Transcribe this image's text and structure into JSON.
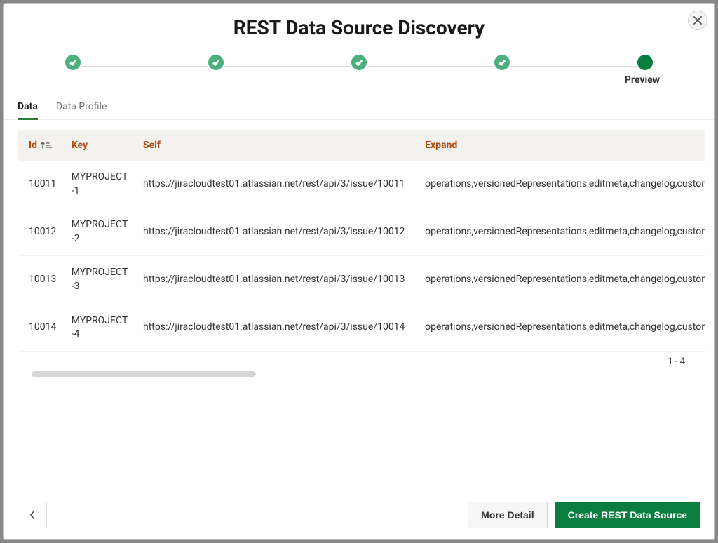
{
  "dialog": {
    "title": "REST Data Source Discovery",
    "current_step_label": "Preview"
  },
  "tabs": [
    {
      "label": "Data",
      "active": true
    },
    {
      "label": "Data Profile",
      "active": false
    }
  ],
  "table": {
    "columns": [
      {
        "label": "Id",
        "sorted": "asc"
      },
      {
        "label": "Key"
      },
      {
        "label": "Self"
      },
      {
        "label": "Expand"
      }
    ],
    "rows": [
      {
        "id": "10011",
        "key": "MYPROJECT-1",
        "self": "https://jiracloudtest01.atlassian.net/rest/api/3/issue/10011",
        "expand": "operations,versionedRepresentations,editmeta,changelog,custon"
      },
      {
        "id": "10012",
        "key": "MYPROJECT-2",
        "self": "https://jiracloudtest01.atlassian.net/rest/api/3/issue/10012",
        "expand": "operations,versionedRepresentations,editmeta,changelog,custon"
      },
      {
        "id": "10013",
        "key": "MYPROJECT-3",
        "self": "https://jiracloudtest01.atlassian.net/rest/api/3/issue/10013",
        "expand": "operations,versionedRepresentations,editmeta,changelog,custon"
      },
      {
        "id": "10014",
        "key": "MYPROJECT-4",
        "self": "https://jiracloudtest01.atlassian.net/rest/api/3/issue/10014",
        "expand": "operations,versionedRepresentations,editmeta,changelog,custon"
      }
    ],
    "range_label": "1 - 4"
  },
  "footer": {
    "more_detail": "More Detail",
    "create": "Create REST Data Source"
  }
}
